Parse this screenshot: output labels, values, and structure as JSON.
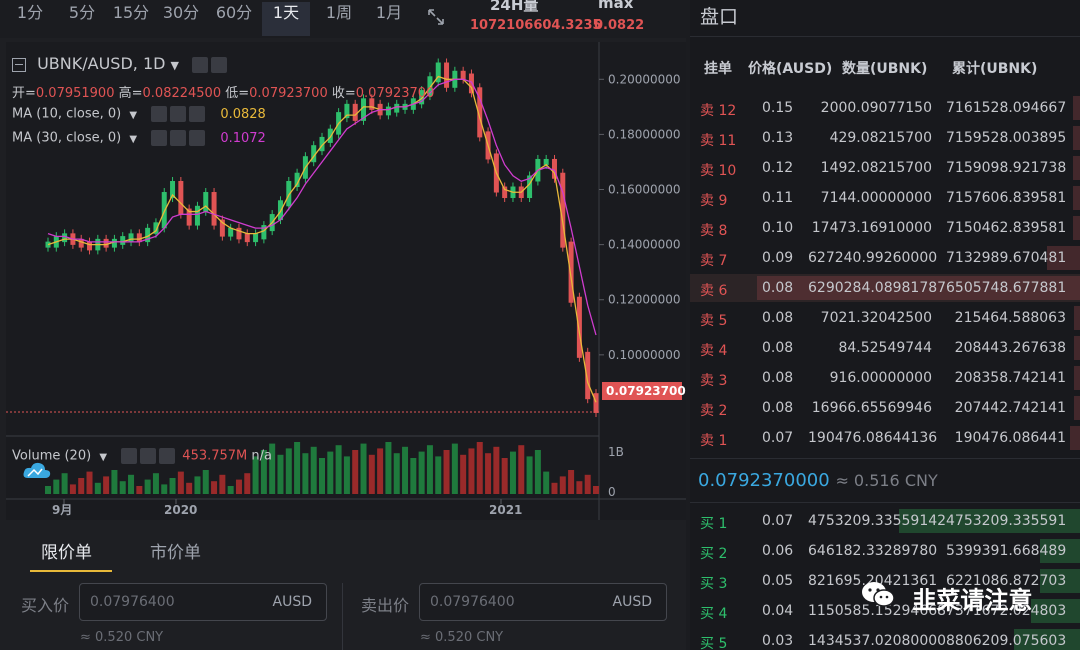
{
  "timeframes": [
    {
      "label": "1分",
      "active": false
    },
    {
      "label": "5分",
      "active": false
    },
    {
      "label": "15分",
      "active": false
    },
    {
      "label": "30分",
      "active": false
    },
    {
      "label": "60分",
      "active": false
    },
    {
      "label": "1天",
      "active": true
    },
    {
      "label": "1周",
      "active": false
    },
    {
      "label": "1月",
      "active": false
    }
  ],
  "stats": {
    "volume_label": "24H量",
    "volume_value": "1072106604.3235",
    "max_label": "max",
    "max_value": "0.0822"
  },
  "chart": {
    "symbol": "UBNK/AUSD, 1D",
    "open_label": "开=",
    "open": "0.07951900",
    "high_label": "高=",
    "high": "0.08224500",
    "low_label": "低=",
    "low": "0.07923700",
    "close_label": "收=",
    "close": "0.07923700",
    "ma10_label": "MA (10, close, 0)",
    "ma10_value": "0.0828",
    "ma30_label": "MA (30, close, 0)",
    "ma30_value": "0.1072",
    "volume_label": "Volume (20)",
    "volume_value": "453.757M",
    "volume_value2": "n/a",
    "current_price_tag": "0.07923700",
    "colors": {
      "up": "#2ebf6c",
      "down": "#e05454",
      "ma10": "#e8b93a",
      "ma30": "#d03ccf"
    }
  },
  "chart_data": {
    "type": "line",
    "title": "",
    "y_ticks": [
      "0.20000000",
      "0.18000000",
      "0.16000000",
      "0.14000000",
      "0.12000000",
      "0.10000000"
    ],
    "ylim": [
      0.072,
      0.207
    ],
    "x_ticks": [
      "9月",
      "2020",
      "2021"
    ],
    "volume_ticks": [
      "1B",
      "0"
    ],
    "series": [
      {
        "name": "price",
        "values": [
          0.14,
          0.142,
          0.143,
          0.141,
          0.14,
          0.139,
          0.141,
          0.14,
          0.141,
          0.142,
          0.143,
          0.142,
          0.145,
          0.147,
          0.158,
          0.162,
          0.152,
          0.148,
          0.153,
          0.158,
          0.148,
          0.144,
          0.145,
          0.143,
          0.142,
          0.143,
          0.146,
          0.15,
          0.155,
          0.162,
          0.165,
          0.171,
          0.175,
          0.178,
          0.181,
          0.187,
          0.19,
          0.186,
          0.192,
          0.19,
          0.188,
          0.189,
          0.19,
          0.19,
          0.192,
          0.195,
          0.2,
          0.205,
          0.198,
          0.202,
          0.201,
          0.196,
          0.18,
          0.172,
          0.16,
          0.158,
          0.16,
          0.158,
          0.164,
          0.17,
          0.17,
          0.165,
          0.14,
          0.12,
          0.1,
          0.085,
          0.08
        ]
      },
      {
        "name": "MA 10",
        "values": [
          0.14,
          0.141,
          0.142,
          0.142,
          0.141,
          0.14,
          0.14,
          0.14,
          0.141,
          0.141,
          0.142,
          0.142,
          0.143,
          0.145,
          0.152,
          0.158,
          0.155,
          0.152,
          0.152,
          0.154,
          0.151,
          0.148,
          0.146,
          0.145,
          0.144,
          0.144,
          0.145,
          0.148,
          0.152,
          0.158,
          0.162,
          0.168,
          0.172,
          0.176,
          0.179,
          0.184,
          0.187,
          0.187,
          0.19,
          0.19,
          0.189,
          0.189,
          0.19,
          0.19,
          0.191,
          0.193,
          0.197,
          0.201,
          0.2,
          0.2,
          0.2,
          0.197,
          0.186,
          0.176,
          0.166,
          0.16,
          0.159,
          0.159,
          0.162,
          0.167,
          0.169,
          0.166,
          0.148,
          0.128,
          0.108,
          0.09,
          0.0828
        ]
      },
      {
        "name": "MA 30",
        "values": [
          0.144,
          0.143,
          0.143,
          0.142,
          0.142,
          0.141,
          0.141,
          0.141,
          0.141,
          0.141,
          0.141,
          0.141,
          0.142,
          0.143,
          0.146,
          0.15,
          0.151,
          0.151,
          0.151,
          0.152,
          0.151,
          0.15,
          0.149,
          0.148,
          0.147,
          0.146,
          0.146,
          0.147,
          0.149,
          0.153,
          0.157,
          0.162,
          0.166,
          0.17,
          0.174,
          0.178,
          0.182,
          0.184,
          0.186,
          0.188,
          0.189,
          0.189,
          0.19,
          0.19,
          0.191,
          0.192,
          0.195,
          0.198,
          0.199,
          0.2,
          0.2,
          0.199,
          0.193,
          0.185,
          0.176,
          0.169,
          0.165,
          0.163,
          0.164,
          0.167,
          0.168,
          0.167,
          0.159,
          0.146,
          0.132,
          0.118,
          0.1072
        ]
      }
    ]
  },
  "order_form": {
    "tabs": [
      {
        "label": "限价单",
        "active": true
      },
      {
        "label": "市价单",
        "active": false
      }
    ],
    "buy_label": "买入价",
    "buy_price": "0.07976400",
    "buy_unit": "AUSD",
    "buy_cny": "≈ 0.520 CNY",
    "sell_label": "卖出价",
    "sell_price": "0.07976400",
    "sell_unit": "AUSD",
    "sell_cny": "≈ 0.520 CNY"
  },
  "orderbook": {
    "title": "盘口",
    "headers": {
      "side": "挂单",
      "price": "价格(AUSD)",
      "amount": "数量(UBNK)",
      "total": "累计(UBNK)"
    },
    "asks": [
      {
        "label": "卖 12",
        "price": "0.15",
        "amount": "2000.09077150",
        "total": "7161528.094667",
        "depth": 0.02
      },
      {
        "label": "卖 11",
        "price": "0.13",
        "amount": "429.08215700",
        "total": "7159528.003895",
        "depth": 0.02
      },
      {
        "label": "卖 10",
        "price": "0.12",
        "amount": "1492.08215700",
        "total": "7159098.921738",
        "depth": 0.02
      },
      {
        "label": "卖 9",
        "price": "0.11",
        "amount": "7144.00000000",
        "total": "7157606.839581",
        "depth": 0.02
      },
      {
        "label": "卖 8",
        "price": "0.10",
        "amount": "17473.16910000",
        "total": "7150462.839581",
        "depth": 0.02
      },
      {
        "label": "卖 7",
        "price": "0.09",
        "amount": "627240.99260000",
        "total": "7132989.670481",
        "depth": 0.1
      },
      {
        "label": "卖 6",
        "price": "0.08",
        "amount": "6290284.08981787",
        "total": "6505748.677881",
        "depth": 0.98
      },
      {
        "label": "卖 5",
        "price": "0.08",
        "amount": "7021.32042500",
        "total": "215464.588063",
        "depth": 0.01
      },
      {
        "label": "卖 4",
        "price": "0.08",
        "amount": "84.52549744",
        "total": "208443.267638",
        "depth": 0.01
      },
      {
        "label": "卖 3",
        "price": "0.08",
        "amount": "916.00000000",
        "total": "208358.742141",
        "depth": 0.01
      },
      {
        "label": "卖 2",
        "price": "0.08",
        "amount": "16966.65569946",
        "total": "207442.742141",
        "depth": 0.01
      },
      {
        "label": "卖 1",
        "price": "0.07",
        "amount": "190476.08644136",
        "total": "190476.086441",
        "depth": 0.03
      }
    ],
    "last_price": "0.0792370000",
    "last_cny": "≈ 0.516 CNY",
    "bids": [
      {
        "label": "买 1",
        "price": "0.07",
        "amount": "4753209.33559142",
        "total": "4753209.335591",
        "depth": 0.55
      },
      {
        "label": "买 2",
        "price": "0.06",
        "amount": "646182.33289780",
        "total": "5399391.668489",
        "depth": 0.12
      },
      {
        "label": "买 3",
        "price": "0.05",
        "amount": "821695.20421361",
        "total": "6221086.872703",
        "depth": 0.12
      },
      {
        "label": "买 4",
        "price": "0.04",
        "amount": "1150585.15294668",
        "total": "7371672.024803",
        "depth": 0.15
      },
      {
        "label": "买 5",
        "price": "0.03",
        "amount": "1434537.02080000",
        "total": "8806209.075603",
        "depth": 0.2
      }
    ]
  },
  "watermark": {
    "text": "韭菜请注意"
  }
}
